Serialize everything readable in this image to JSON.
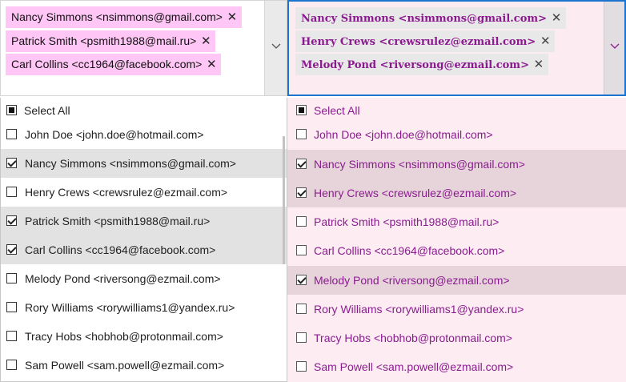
{
  "left": {
    "tokens": [
      {
        "label": "Nancy Simmons <nsimmons@gmail.com>",
        "remove": "✕"
      },
      {
        "label": "Patrick Smith <psmith1988@mail.ru>",
        "remove": "✕"
      },
      {
        "label": "Carl Collins <cc1964@facebook.com>",
        "remove": "✕"
      }
    ],
    "select_all": "Select All",
    "items": [
      {
        "label": "John Doe <john.doe@hotmail.com>",
        "checked": false
      },
      {
        "label": "Nancy Simmons <nsimmons@gmail.com>",
        "checked": true
      },
      {
        "label": "Henry Crews <crewsrulez@ezmail.com>",
        "checked": false
      },
      {
        "label": "Patrick Smith <psmith1988@mail.ru>",
        "checked": true
      },
      {
        "label": "Carl Collins <cc1964@facebook.com>",
        "checked": true
      },
      {
        "label": "Melody Pond <riversong@ezmail.com>",
        "checked": false
      },
      {
        "label": "Rory Williams <rorywilliams1@yandex.ru>",
        "checked": false
      },
      {
        "label": "Tracy Hobs <hobhob@protonmail.com>",
        "checked": false
      },
      {
        "label": "Sam Powell <sam.powell@ezmail.com>",
        "checked": false
      }
    ]
  },
  "right": {
    "tokens": [
      {
        "label": "Nancy Simmons <nsimmons@gmail.com>",
        "remove": "✕"
      },
      {
        "label": "Henry Crews <crewsrulez@ezmail.com>",
        "remove": "✕"
      },
      {
        "label": "Melody Pond <riversong@ezmail.com>",
        "remove": "✕"
      }
    ],
    "select_all": "Select All",
    "items": [
      {
        "label": "John Doe <john.doe@hotmail.com>",
        "checked": false
      },
      {
        "label": "Nancy Simmons <nsimmons@gmail.com>",
        "checked": true
      },
      {
        "label": "Henry Crews <crewsrulez@ezmail.com>",
        "checked": true
      },
      {
        "label": "Patrick Smith <psmith1988@mail.ru>",
        "checked": false
      },
      {
        "label": "Carl Collins <cc1964@facebook.com>",
        "checked": false
      },
      {
        "label": "Melody Pond <riversong@ezmail.com>",
        "checked": true
      },
      {
        "label": "Rory Williams <rorywilliams1@yandex.ru>",
        "checked": false
      },
      {
        "label": "Tracy Hobs <hobhob@protonmail.com>",
        "checked": false
      },
      {
        "label": "Sam Powell <sam.powell@ezmail.com>",
        "checked": false
      }
    ]
  },
  "colors": {
    "left_token_bg": "#ffc6f6",
    "right_panel_bg": "#fdecf1",
    "right_text": "#8a1c90",
    "focus_border": "#1d74d0",
    "selected_row_left": "#e2e2e2",
    "selected_row_right": "#e7d3da"
  },
  "icons": {
    "dropdown": "chevron-down-icon",
    "remove": "close-icon",
    "checkbox": "checkbox-icon"
  }
}
